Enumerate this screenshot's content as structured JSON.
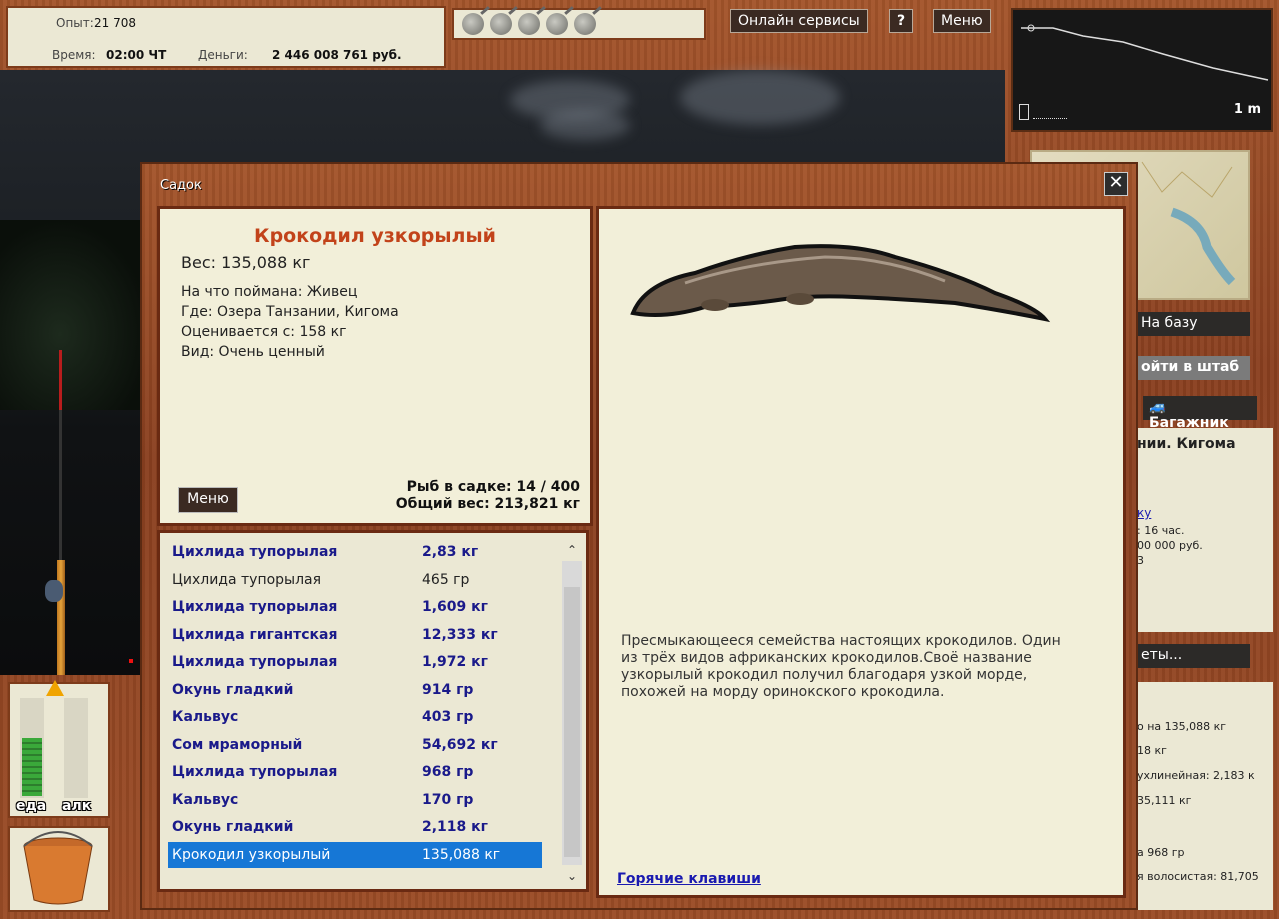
{
  "stats": {
    "exp_label": "Опыт:",
    "exp_value": "21 708",
    "time_label": "Время:",
    "time_value": "02:00 ЧТ",
    "money_label": "Деньги:",
    "money_value": "2 446 008 761 руб."
  },
  "top_buttons": {
    "online": "Онлайн сервисы",
    "help": "?",
    "menu": "Меню"
  },
  "depth": {
    "value": "1 m"
  },
  "side": {
    "to_base": "На базу",
    "to_hq": "ойти в штаб",
    "trunk": "Багажник",
    "location_fragment": "нии. Кигома",
    "link_fragment": "ку",
    "line1": ": 16 час.",
    "line2": "00 000 руб.",
    "line3": "3",
    "tips_button": "еты...",
    "rec1": "о на 135,088 кг",
    "rec2": "18 кг",
    "rec3": "ухлинейная: 2,183 к",
    "rec4": "35,111 кг",
    "rec5": "а 968 гр",
    "rec6": "я волосистая: 81,705"
  },
  "meters": {
    "food_label": "еда",
    "alc_label": "алк",
    "food_level": 0.6,
    "alc_level": 0.0
  },
  "dialog": {
    "title": "Садок",
    "close": "✕",
    "fish": {
      "name": "Крокодил узкорылый",
      "weight": "Вес: 135,088 кг",
      "bait": "На что поймана: Живец",
      "where": "Где: Озера Танзании, Кигома",
      "rated_from": "Оценивается с: 158 кг",
      "kind": "Вид: Очень ценный"
    },
    "menu_button": "Меню",
    "fish_count": "Рыб в садке: 14 / 400",
    "total_weight": "Общий вес: 213,821 кг",
    "catch_list": [
      {
        "name": "Цихлида тупорылая",
        "weight": "2,83 кг",
        "style": "b"
      },
      {
        "name": "Цихлида тупорылая",
        "weight": "465 гр",
        "style": "plain"
      },
      {
        "name": "Цихлида тупорылая",
        "weight": "1,609 кг",
        "style": "b"
      },
      {
        "name": "Цихлида гигантская",
        "weight": "12,333 кг",
        "style": "b"
      },
      {
        "name": "Цихлида тупорылая",
        "weight": "1,972 кг",
        "style": "b"
      },
      {
        "name": "Окунь гладкий",
        "weight": "914 гр",
        "style": "b"
      },
      {
        "name": "Кальвус",
        "weight": "403 гр",
        "style": "b"
      },
      {
        "name": "Сом мраморный",
        "weight": "54,692 кг",
        "style": "b"
      },
      {
        "name": "Цихлида тупорылая",
        "weight": "968 гр",
        "style": "b"
      },
      {
        "name": "Кальвус",
        "weight": "170 гр",
        "style": "b"
      },
      {
        "name": "Окунь гладкий",
        "weight": "2,118 кг",
        "style": "b"
      },
      {
        "name": "Крокодил узкорылый",
        "weight": "135,088 кг",
        "style": "sel"
      }
    ],
    "description": "Пресмыкающееся семейства настоящих крокодилов. Один из трёх видов африканских крокодилов.Своё название узкорылый крокодил получил благодаря узкой морде, похожей на морду оринокского крокодила.",
    "hotkeys": "Горячие клавиши"
  }
}
